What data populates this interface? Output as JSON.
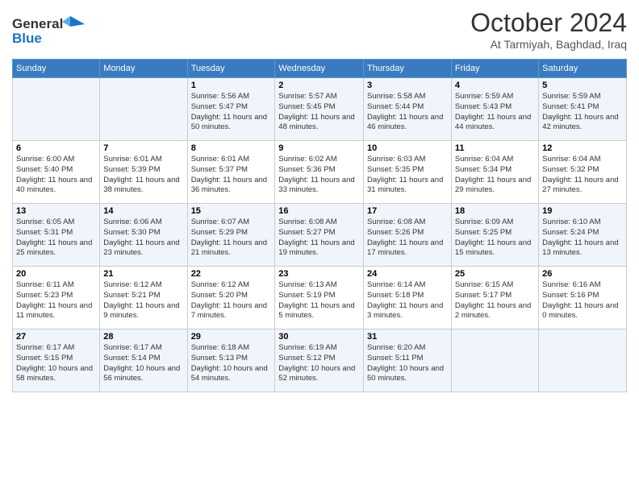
{
  "header": {
    "logo_line1": "General",
    "logo_line2": "Blue",
    "month_title": "October 2024",
    "subtitle": "At Tarmiyah, Baghdad, Iraq"
  },
  "weekdays": [
    "Sunday",
    "Monday",
    "Tuesday",
    "Wednesday",
    "Thursday",
    "Friday",
    "Saturday"
  ],
  "weeks": [
    [
      {
        "day": "",
        "info": ""
      },
      {
        "day": "",
        "info": ""
      },
      {
        "day": "1",
        "info": "Sunrise: 5:56 AM\nSunset: 5:47 PM\nDaylight: 11 hours and 50 minutes."
      },
      {
        "day": "2",
        "info": "Sunrise: 5:57 AM\nSunset: 5:45 PM\nDaylight: 11 hours and 48 minutes."
      },
      {
        "day": "3",
        "info": "Sunrise: 5:58 AM\nSunset: 5:44 PM\nDaylight: 11 hours and 46 minutes."
      },
      {
        "day": "4",
        "info": "Sunrise: 5:59 AM\nSunset: 5:43 PM\nDaylight: 11 hours and 44 minutes."
      },
      {
        "day": "5",
        "info": "Sunrise: 5:59 AM\nSunset: 5:41 PM\nDaylight: 11 hours and 42 minutes."
      }
    ],
    [
      {
        "day": "6",
        "info": "Sunrise: 6:00 AM\nSunset: 5:40 PM\nDaylight: 11 hours and 40 minutes."
      },
      {
        "day": "7",
        "info": "Sunrise: 6:01 AM\nSunset: 5:39 PM\nDaylight: 11 hours and 38 minutes."
      },
      {
        "day": "8",
        "info": "Sunrise: 6:01 AM\nSunset: 5:37 PM\nDaylight: 11 hours and 36 minutes."
      },
      {
        "day": "9",
        "info": "Sunrise: 6:02 AM\nSunset: 5:36 PM\nDaylight: 11 hours and 33 minutes."
      },
      {
        "day": "10",
        "info": "Sunrise: 6:03 AM\nSunset: 5:35 PM\nDaylight: 11 hours and 31 minutes."
      },
      {
        "day": "11",
        "info": "Sunrise: 6:04 AM\nSunset: 5:34 PM\nDaylight: 11 hours and 29 minutes."
      },
      {
        "day": "12",
        "info": "Sunrise: 6:04 AM\nSunset: 5:32 PM\nDaylight: 11 hours and 27 minutes."
      }
    ],
    [
      {
        "day": "13",
        "info": "Sunrise: 6:05 AM\nSunset: 5:31 PM\nDaylight: 11 hours and 25 minutes."
      },
      {
        "day": "14",
        "info": "Sunrise: 6:06 AM\nSunset: 5:30 PM\nDaylight: 11 hours and 23 minutes."
      },
      {
        "day": "15",
        "info": "Sunrise: 6:07 AM\nSunset: 5:29 PM\nDaylight: 11 hours and 21 minutes."
      },
      {
        "day": "16",
        "info": "Sunrise: 6:08 AM\nSunset: 5:27 PM\nDaylight: 11 hours and 19 minutes."
      },
      {
        "day": "17",
        "info": "Sunrise: 6:08 AM\nSunset: 5:26 PM\nDaylight: 11 hours and 17 minutes."
      },
      {
        "day": "18",
        "info": "Sunrise: 6:09 AM\nSunset: 5:25 PM\nDaylight: 11 hours and 15 minutes."
      },
      {
        "day": "19",
        "info": "Sunrise: 6:10 AM\nSunset: 5:24 PM\nDaylight: 11 hours and 13 minutes."
      }
    ],
    [
      {
        "day": "20",
        "info": "Sunrise: 6:11 AM\nSunset: 5:23 PM\nDaylight: 11 hours and 11 minutes."
      },
      {
        "day": "21",
        "info": "Sunrise: 6:12 AM\nSunset: 5:21 PM\nDaylight: 11 hours and 9 minutes."
      },
      {
        "day": "22",
        "info": "Sunrise: 6:12 AM\nSunset: 5:20 PM\nDaylight: 11 hours and 7 minutes."
      },
      {
        "day": "23",
        "info": "Sunrise: 6:13 AM\nSunset: 5:19 PM\nDaylight: 11 hours and 5 minutes."
      },
      {
        "day": "24",
        "info": "Sunrise: 6:14 AM\nSunset: 5:18 PM\nDaylight: 11 hours and 3 minutes."
      },
      {
        "day": "25",
        "info": "Sunrise: 6:15 AM\nSunset: 5:17 PM\nDaylight: 11 hours and 2 minutes."
      },
      {
        "day": "26",
        "info": "Sunrise: 6:16 AM\nSunset: 5:16 PM\nDaylight: 11 hours and 0 minutes."
      }
    ],
    [
      {
        "day": "27",
        "info": "Sunrise: 6:17 AM\nSunset: 5:15 PM\nDaylight: 10 hours and 58 minutes."
      },
      {
        "day": "28",
        "info": "Sunrise: 6:17 AM\nSunset: 5:14 PM\nDaylight: 10 hours and 56 minutes."
      },
      {
        "day": "29",
        "info": "Sunrise: 6:18 AM\nSunset: 5:13 PM\nDaylight: 10 hours and 54 minutes."
      },
      {
        "day": "30",
        "info": "Sunrise: 6:19 AM\nSunset: 5:12 PM\nDaylight: 10 hours and 52 minutes."
      },
      {
        "day": "31",
        "info": "Sunrise: 6:20 AM\nSunset: 5:11 PM\nDaylight: 10 hours and 50 minutes."
      },
      {
        "day": "",
        "info": ""
      },
      {
        "day": "",
        "info": ""
      }
    ]
  ]
}
